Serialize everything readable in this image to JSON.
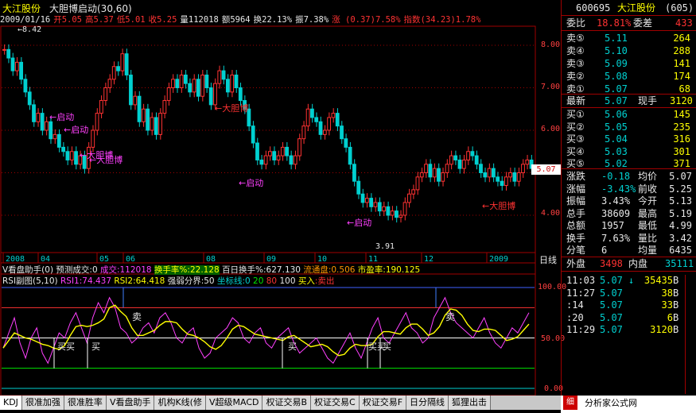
{
  "title": {
    "stock_name": "大江股份",
    "indicator": "大胆博启动(30,60)"
  },
  "quote": {
    "date": "2009/01/16",
    "open": "开5.05",
    "high": "高5.37",
    "low": "低5.01",
    "close": "收5.25",
    "volume": "量112018",
    "amount": "额5964",
    "turnover": "换22.13%",
    "amplitude": "振7.38%",
    "change": "涨 (0.37)7.58%",
    "index": "指数(34.23)1.78%"
  },
  "main_chart": {
    "max_label": "8.42",
    "y_ticks": [
      "8.00",
      "7.00",
      "6.00",
      "5.00",
      "4.00"
    ],
    "current_price_tag": "5.07",
    "x_ticks": [
      "2008",
      "04",
      "05",
      "06",
      "08",
      "09",
      "10",
      "11",
      "12",
      "2009"
    ],
    "period": "日线",
    "annotations": [
      "启动",
      "启动",
      "大胆博",
      "大胆博",
      "启动",
      "大胆博",
      "启动",
      "大胆博"
    ],
    "low_label": "3.91"
  },
  "assist_bar": {
    "name": "V看盘助手(0)",
    "predict_vol": "预测成交:0",
    "vol": "成交:112018",
    "turnover_rate": "换手率%:22.128",
    "hundred_day": "百日换手%:627.130",
    "float_label": "流通盘:0.506",
    "pe": "市盈率:190.125"
  },
  "rsi_bar": {
    "name": "RSI副图(5,10)",
    "rsi1": "RSI1:74.437",
    "rsi2": "RSI2:64.418",
    "strength": "强弱分界:50",
    "coord": "坐标线:0",
    "v20": "20",
    "v80": "80",
    "v100": "100",
    "buy": "买入",
    "sell": "卖出",
    "y_ticks": [
      "100.00",
      "50.00",
      "0.00"
    ],
    "sell_marks": [
      "卖",
      "卖"
    ],
    "buy_marks": [
      "买买",
      "买",
      "买",
      "买买",
      "买"
    ]
  },
  "right_panel": {
    "code": "600695",
    "name": "大江股份",
    "code_num": "(605)",
    "weibi_label": "委比",
    "weibi": "18.81%",
    "weicha_label": "委差",
    "weicha": "433",
    "sell_orders": [
      {
        "label": "卖⑤",
        "price": "5.11",
        "vol": "264"
      },
      {
        "label": "卖④",
        "price": "5.10",
        "vol": "288"
      },
      {
        "label": "卖③",
        "price": "5.09",
        "vol": "141"
      },
      {
        "label": "卖②",
        "price": "5.08",
        "vol": "174"
      },
      {
        "label": "卖①",
        "price": "5.07",
        "vol": "68"
      }
    ],
    "latest_label": "最新",
    "latest": "5.07",
    "hand_label": "现手",
    "hand": "3120",
    "buy_orders": [
      {
        "label": "买①",
        "price": "5.06",
        "vol": "145"
      },
      {
        "label": "买②",
        "price": "5.05",
        "vol": "235"
      },
      {
        "label": "买③",
        "price": "5.04",
        "vol": "316"
      },
      {
        "label": "买④",
        "price": "5.03",
        "vol": "301"
      },
      {
        "label": "买⑤",
        "price": "5.02",
        "vol": "371"
      }
    ],
    "stats": [
      {
        "l1": "涨跌",
        "v1": "-0.18",
        "l2": "均价",
        "v2": "5.07"
      },
      {
        "l1": "涨幅",
        "v1": "-3.43%",
        "l2": "前收",
        "v2": "5.25"
      },
      {
        "l1": "振幅",
        "v1": "3.43%",
        "l2": "今开",
        "v2": "5.13"
      },
      {
        "l1": "总手",
        "v1": "38609",
        "l2": "最高",
        "v2": "5.19"
      },
      {
        "l1": "总额",
        "v1": "1957",
        "l2": "最低",
        "v2": "4.99"
      },
      {
        "l1": "换手",
        "v1": "7.63%",
        "l2": "量比",
        "v2": "3.42"
      },
      {
        "l1": "分笔",
        "v1": "6",
        "l2": "均量",
        "v2": "6435"
      }
    ],
    "outer_label": "外盘",
    "outer": "3498",
    "inner_label": "内盘",
    "inner": "35111",
    "ticks": [
      {
        "time": "11:03",
        "price": "5.07",
        "arrow": "↓",
        "vol": "35435",
        "side": "B"
      },
      {
        "time": "11:27",
        "price": "5.07",
        "arrow": "",
        "vol": "38",
        "side": "B"
      },
      {
        "time": ":14",
        "price": "5.07",
        "arrow": "",
        "vol": "33",
        "side": "B"
      },
      {
        "time": ":20",
        "price": "5.07",
        "arrow": "",
        "vol": "6",
        "side": "B"
      },
      {
        "time": "11:29",
        "price": "5.07",
        "arrow": "",
        "vol": "3120",
        "side": "B"
      }
    ]
  },
  "tabs": [
    "KDJ",
    "很准加强",
    "很准胜率",
    "V看盘助手",
    "机构K线(修",
    "V超级MACD",
    "权证交易B",
    "权证交易C",
    "权证交易F",
    "日分隔线",
    "狐狸出击"
  ],
  "footer": {
    "site": "分析家公式网www.88gs.com"
  },
  "colors": {
    "up": "#ff3232",
    "down": "#00d0d0",
    "rsi1": "#ff40ff",
    "rsi2": "#ffff00",
    "grid": "#a00000"
  }
}
